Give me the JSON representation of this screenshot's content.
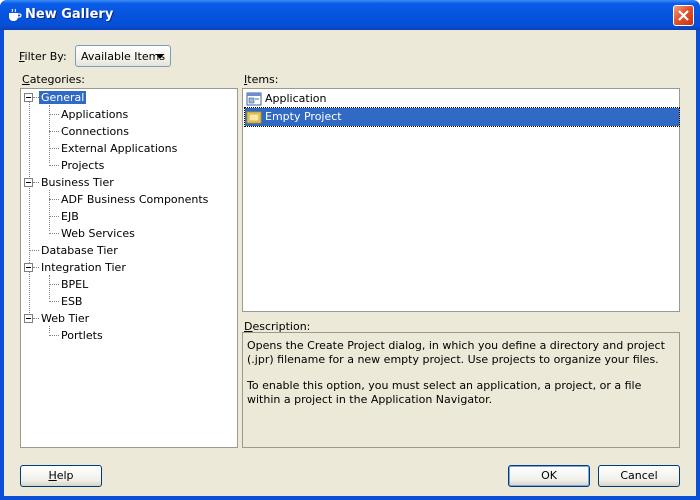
{
  "window": {
    "title": "New Gallery"
  },
  "filter": {
    "label_prefix": "F",
    "label_rest": "ilter By:",
    "selected": "Available Items"
  },
  "categories": {
    "label_prefix": "C",
    "label_rest": "ategories:",
    "tree": [
      {
        "label": "General",
        "level": 0,
        "expanded": true,
        "selected": true
      },
      {
        "label": "Applications",
        "level": 1
      },
      {
        "label": "Connections",
        "level": 1
      },
      {
        "label": "External Applications",
        "level": 1
      },
      {
        "label": "Projects",
        "level": 1
      },
      {
        "label": "Business Tier",
        "level": 0,
        "expanded": true
      },
      {
        "label": "ADF Business Components",
        "level": 1
      },
      {
        "label": "EJB",
        "level": 1
      },
      {
        "label": "Web Services",
        "level": 1
      },
      {
        "label": "Database Tier",
        "level": 0
      },
      {
        "label": "Integration Tier",
        "level": 0,
        "expanded": true
      },
      {
        "label": "BPEL",
        "level": 1
      },
      {
        "label": "ESB",
        "level": 1
      },
      {
        "label": "Web Tier",
        "level": 0,
        "expanded": true
      },
      {
        "label": "Portlets",
        "level": 1
      }
    ]
  },
  "items": {
    "label_prefix": "I",
    "label_rest": "tems:",
    "list": [
      {
        "label": "Application",
        "icon": "application-icon"
      },
      {
        "label": "Empty Project",
        "icon": "folder-icon",
        "selected": true
      }
    ]
  },
  "description": {
    "label_prefix": "D",
    "label_rest": "escription:",
    "para1": "Opens the Create Project dialog, in which you define a directory and project (.jpr) filename for a new empty project. Use projects to organize your files.",
    "para2": "To enable this option, you must select an application, a project, or a file within a project in the Application Navigator."
  },
  "buttons": {
    "help_prefix": "H",
    "help_rest": "elp",
    "ok": "OK",
    "cancel": "Cancel"
  },
  "colors": {
    "title_blue": "#0653de",
    "selection": "#316ac5",
    "dialog_face": "#ece9d8",
    "close_red": "#e0542e"
  }
}
